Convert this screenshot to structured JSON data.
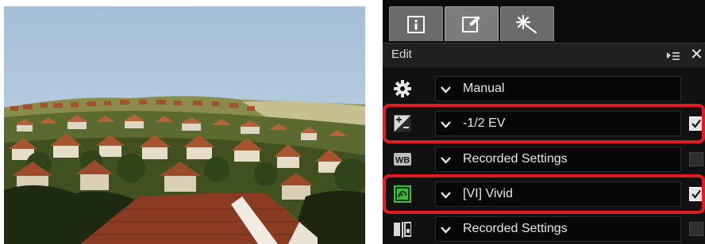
{
  "panel": {
    "tabs": [
      {
        "icon": "info-icon"
      },
      {
        "icon": "edit-pencil-icon",
        "active": true
      },
      {
        "icon": "magic-wand-icon"
      }
    ],
    "edit_title": "Edit",
    "menu_icon": "panel-menu-icon",
    "close_label": "✕",
    "rows": [
      {
        "icon": "gear-icon",
        "value": "Manual",
        "checked": null
      },
      {
        "icon": "exposure-compensation-icon",
        "value": "-1/2 EV",
        "checked": true,
        "highlighted": true
      },
      {
        "icon": "white-balance-icon",
        "value": "Recorded Settings",
        "checked": false
      },
      {
        "icon": "picture-control-icon",
        "value": "[VI] Vivid",
        "checked": true,
        "highlighted": true
      },
      {
        "icon": "picture-settings-icon",
        "value": "Recorded Settings",
        "checked": false
      }
    ]
  },
  "colors": {
    "highlight": "#e11b22",
    "panel_bg": "#111111",
    "picture_control_green": "#3dbb3d"
  }
}
